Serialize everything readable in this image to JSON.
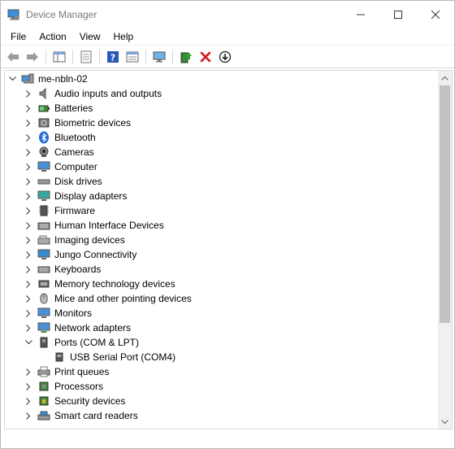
{
  "window": {
    "title": "Device Manager",
    "accent_color": "#cc0000"
  },
  "menu": [
    "File",
    "Action",
    "View",
    "Help"
  ],
  "toolbar_icons": [
    "back-arrow-icon",
    "forward-arrow-icon",
    "show-hide-tree-icon",
    "properties-icon",
    "help-icon",
    "device-view-icon",
    "scan-hardware-icon",
    "update-driver-icon",
    "uninstall-device-icon",
    "disable-device-icon"
  ],
  "tree": {
    "root": {
      "label": "me-nbln-02",
      "expanded": true
    },
    "categories": [
      {
        "label": "Audio inputs and outputs"
      },
      {
        "label": "Batteries"
      },
      {
        "label": "Biometric devices"
      },
      {
        "label": "Bluetooth"
      },
      {
        "label": "Cameras"
      },
      {
        "label": "Computer"
      },
      {
        "label": "Disk drives"
      },
      {
        "label": "Display adapters"
      },
      {
        "label": "Firmware"
      },
      {
        "label": "Human Interface Devices"
      },
      {
        "label": "Imaging devices"
      },
      {
        "label": "Jungo Connectivity"
      },
      {
        "label": "Keyboards"
      },
      {
        "label": "Memory technology devices"
      },
      {
        "label": "Mice and other pointing devices"
      },
      {
        "label": "Monitors"
      },
      {
        "label": "Network adapters"
      },
      {
        "label": "Ports (COM & LPT)",
        "expanded": true
      },
      {
        "label": "USB Serial Port (COM4)",
        "child": true,
        "highlighted": true
      },
      {
        "label": "Print queues"
      },
      {
        "label": "Processors"
      },
      {
        "label": "Security devices"
      },
      {
        "label": "Smart card readers"
      }
    ]
  }
}
